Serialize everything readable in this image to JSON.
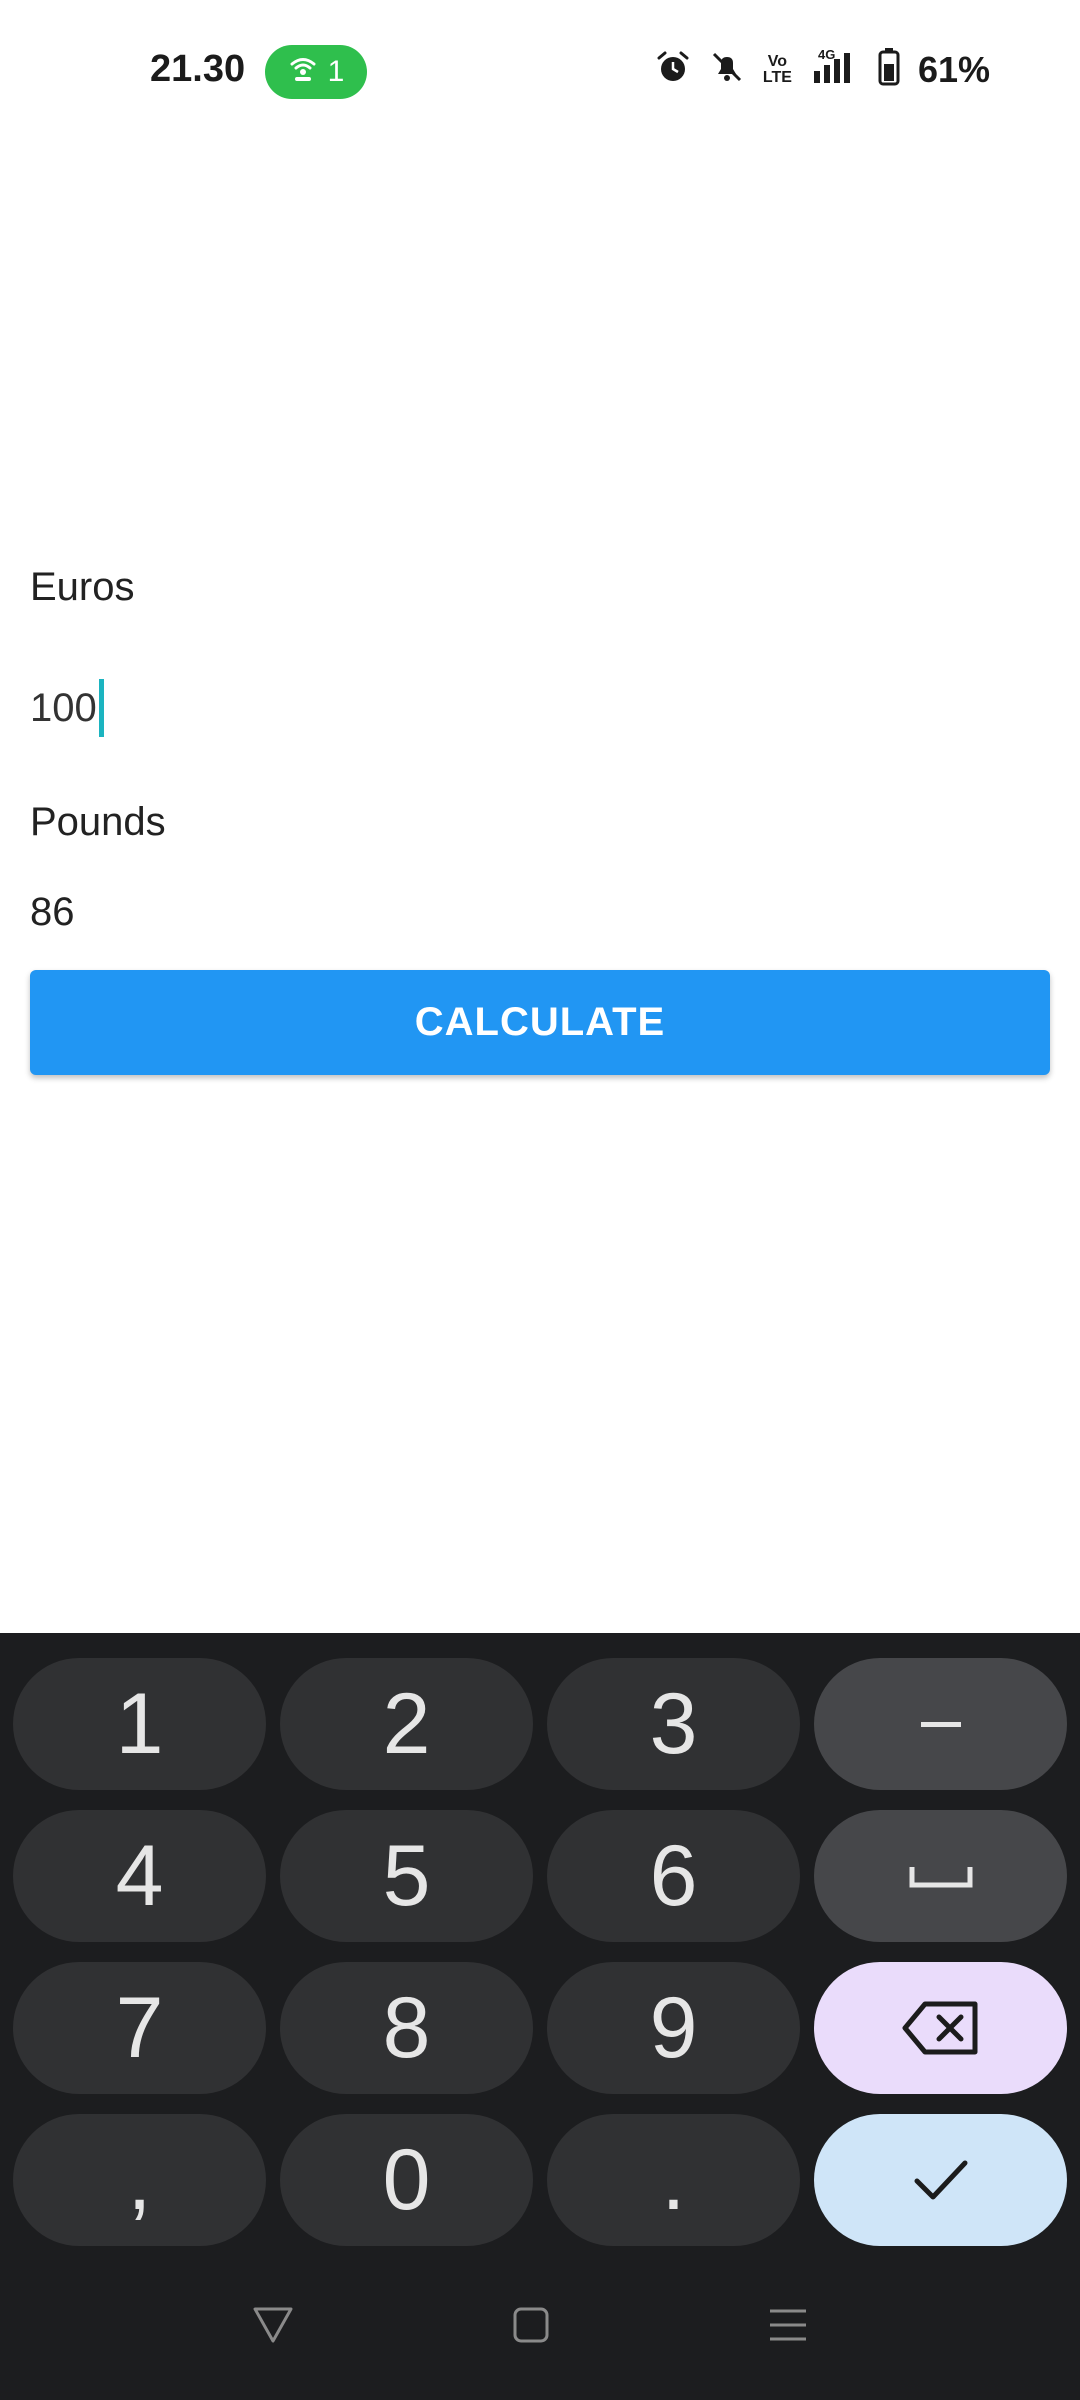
{
  "status_bar": {
    "time": "21.30",
    "hotspot_count": "1",
    "volte": "Vo\nLTE",
    "network": "4G",
    "battery": "61%"
  },
  "form": {
    "euros_label": "Euros",
    "euros_value": "100",
    "pounds_label": "Pounds",
    "pounds_value": "86",
    "calculate_label": "CALCULATE"
  },
  "keyboard": {
    "rows": [
      [
        "1",
        "2",
        "3",
        "–"
      ],
      [
        "4",
        "5",
        "6",
        "␣"
      ],
      [
        "7",
        "8",
        "9",
        "⌫"
      ],
      [
        ",",
        "0",
        ".",
        "✓"
      ]
    ],
    "colors": {
      "background": "#1c1d1f",
      "key": "#303133",
      "function_key": "#46474a",
      "delete_key": "#eadcfb",
      "confirm_key": "#cfe5f8"
    }
  },
  "accent": "#2196f3",
  "hotspot_color": "#2fbf4d",
  "caret_color": "#1bb4c0"
}
